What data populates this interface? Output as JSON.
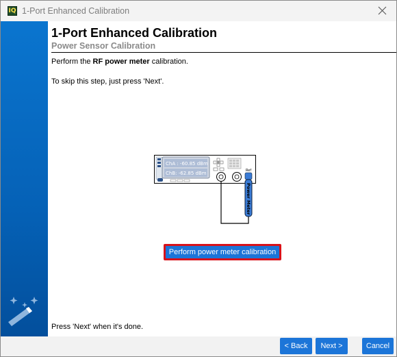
{
  "window": {
    "title": "1-Port Enhanced Calibration",
    "app_icon_text": "IQ"
  },
  "page": {
    "heading": "1-Port Enhanced Calibration",
    "subheading": "Power Sensor Calibration",
    "intro_prefix": "Perform the ",
    "intro_bold": "RF power meter",
    "intro_suffix": " calibration.",
    "skip_text": "To skip this step, just press 'Next'.",
    "done_text": "Press 'Next' when it's done."
  },
  "instrument": {
    "channel_a": "ChA : -60.85 dBm",
    "channel_b": "ChB: -62.85 dBm",
    "ref_label": "Ref",
    "sensor_label": "Power Meter"
  },
  "actions": {
    "calibrate_label": "Perform power meter calibration"
  },
  "footer": {
    "back_label": "< Back",
    "next_label": "Next >",
    "cancel_label": "Cancel"
  },
  "colors": {
    "sidebar": "#0561b6",
    "button": "#1c75d8",
    "highlight_border": "#d8121a"
  }
}
